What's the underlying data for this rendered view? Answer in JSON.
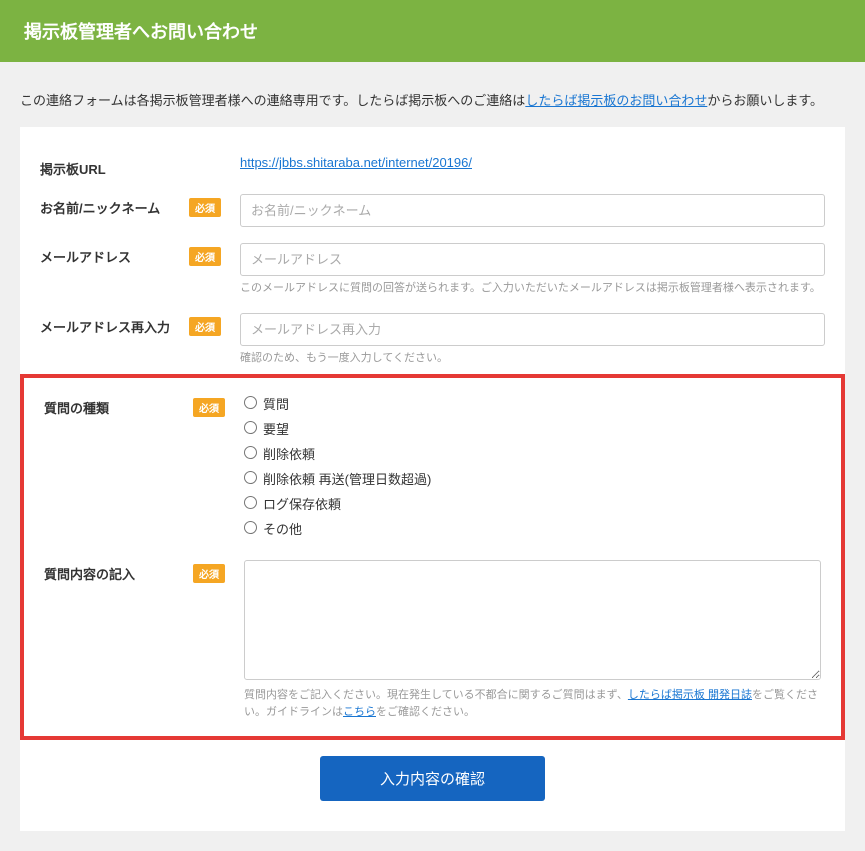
{
  "header": {
    "title": "掲示板管理者へお問い合わせ"
  },
  "intro": {
    "prefix": "この連絡フォームは各掲示板管理者様への連絡専用です。したらば掲示板へのご連絡は",
    "link": "したらば掲示板のお問い合わせ",
    "suffix": "からお願いします。"
  },
  "form": {
    "required_badge": "必須",
    "url": {
      "label": "掲示板URL",
      "value": "https://jbbs.shitaraba.net/internet/20196/"
    },
    "name": {
      "label": "お名前/ニックネーム",
      "placeholder": "お名前/ニックネーム"
    },
    "email": {
      "label": "メールアドレス",
      "placeholder": "メールアドレス",
      "help": "このメールアドレスに質問の回答が送られます。ご入力いただいたメールアドレスは掲示板管理者様へ表示されます。"
    },
    "email_confirm": {
      "label": "メールアドレス再入力",
      "placeholder": "メールアドレス再入力",
      "help": "確認のため、もう一度入力してください。"
    },
    "question_type": {
      "label": "質問の種類",
      "options": [
        "質問",
        "要望",
        "削除依頼",
        "削除依頼 再送(管理日数超過)",
        "ログ保存依頼",
        "その他"
      ]
    },
    "content": {
      "label": "質問内容の記入",
      "help_prefix": "質問内容をご記入ください。現在発生している不都合に関するご質問はまず、",
      "help_link1": "したらば掲示板 開発日誌",
      "help_mid": "をご覧ください。ガイドラインは",
      "help_link2": "こちら",
      "help_suffix": "をご確認ください。"
    },
    "submit": "入力内容の確認"
  }
}
